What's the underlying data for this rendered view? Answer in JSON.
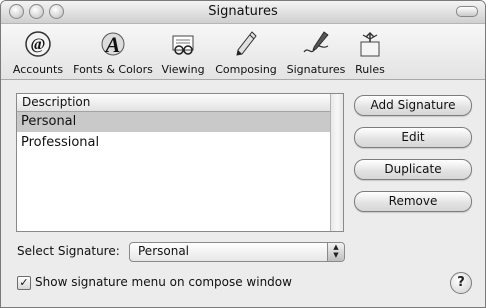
{
  "window": {
    "title": "Signatures"
  },
  "toolbar": {
    "items": [
      {
        "label": "Accounts",
        "icon": "at-sign-icon"
      },
      {
        "label": "Fonts & Colors",
        "icon": "fonts-icon"
      },
      {
        "label": "Viewing",
        "icon": "glasses-icon"
      },
      {
        "label": "Composing",
        "icon": "pencil-icon"
      },
      {
        "label": "Signatures",
        "icon": "signature-pen-icon"
      },
      {
        "label": "Rules",
        "icon": "rules-icon"
      }
    ]
  },
  "signature_list": {
    "header": "Description",
    "rows": [
      "Personal",
      "Professional"
    ],
    "selected_row": 0
  },
  "buttons": {
    "add": "Add Signature",
    "edit": "Edit",
    "duplicate": "Duplicate",
    "remove": "Remove"
  },
  "select_signature": {
    "label": "Select Signature:",
    "value": "Personal"
  },
  "show_menu": {
    "checked": true,
    "label": "Show signature menu on compose window"
  },
  "help": {
    "glyph": "?"
  }
}
